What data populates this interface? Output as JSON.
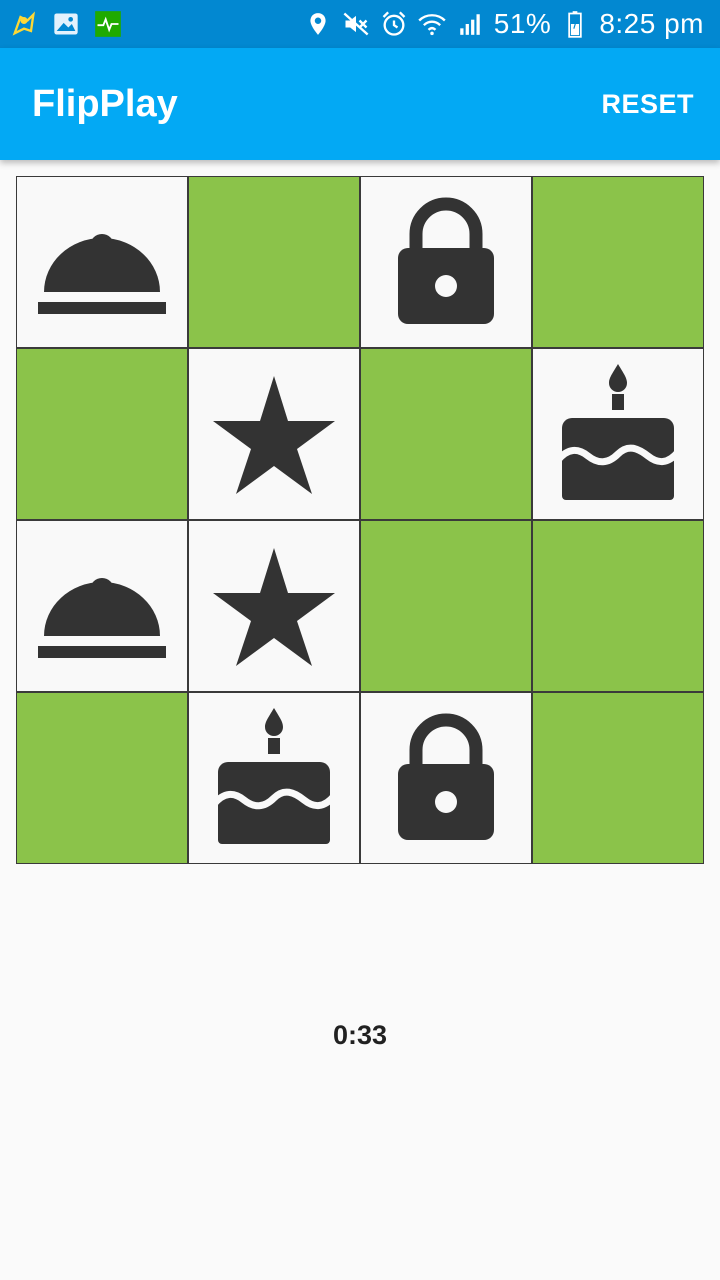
{
  "status_bar": {
    "battery": "51%",
    "time": "8:25 pm",
    "icons": [
      "maps-icon",
      "gallery-icon",
      "health-icon",
      "location-icon",
      "mute-icon",
      "alarm-icon",
      "wifi-icon",
      "signal-icon",
      "battery-icon"
    ]
  },
  "app_bar": {
    "title": "FlipPlay",
    "reset_label": "RESET"
  },
  "board": {
    "colors": {
      "hidden": "#8bc34a",
      "revealed": "#f9f9f9",
      "icon": "#333333"
    },
    "tiles": [
      {
        "state": "revealed",
        "icon": "food-cloche-icon"
      },
      {
        "state": "hidden",
        "icon": ""
      },
      {
        "state": "revealed",
        "icon": "lock-icon"
      },
      {
        "state": "hidden",
        "icon": ""
      },
      {
        "state": "hidden",
        "icon": ""
      },
      {
        "state": "revealed",
        "icon": "star-icon"
      },
      {
        "state": "hidden",
        "icon": ""
      },
      {
        "state": "revealed",
        "icon": "cake-icon"
      },
      {
        "state": "revealed",
        "icon": "food-cloche-icon"
      },
      {
        "state": "revealed",
        "icon": "star-icon"
      },
      {
        "state": "hidden",
        "icon": ""
      },
      {
        "state": "hidden",
        "icon": ""
      },
      {
        "state": "hidden",
        "icon": ""
      },
      {
        "state": "revealed",
        "icon": "cake-icon"
      },
      {
        "state": "revealed",
        "icon": "lock-icon"
      },
      {
        "state": "hidden",
        "icon": ""
      }
    ]
  },
  "timer": "0:33"
}
